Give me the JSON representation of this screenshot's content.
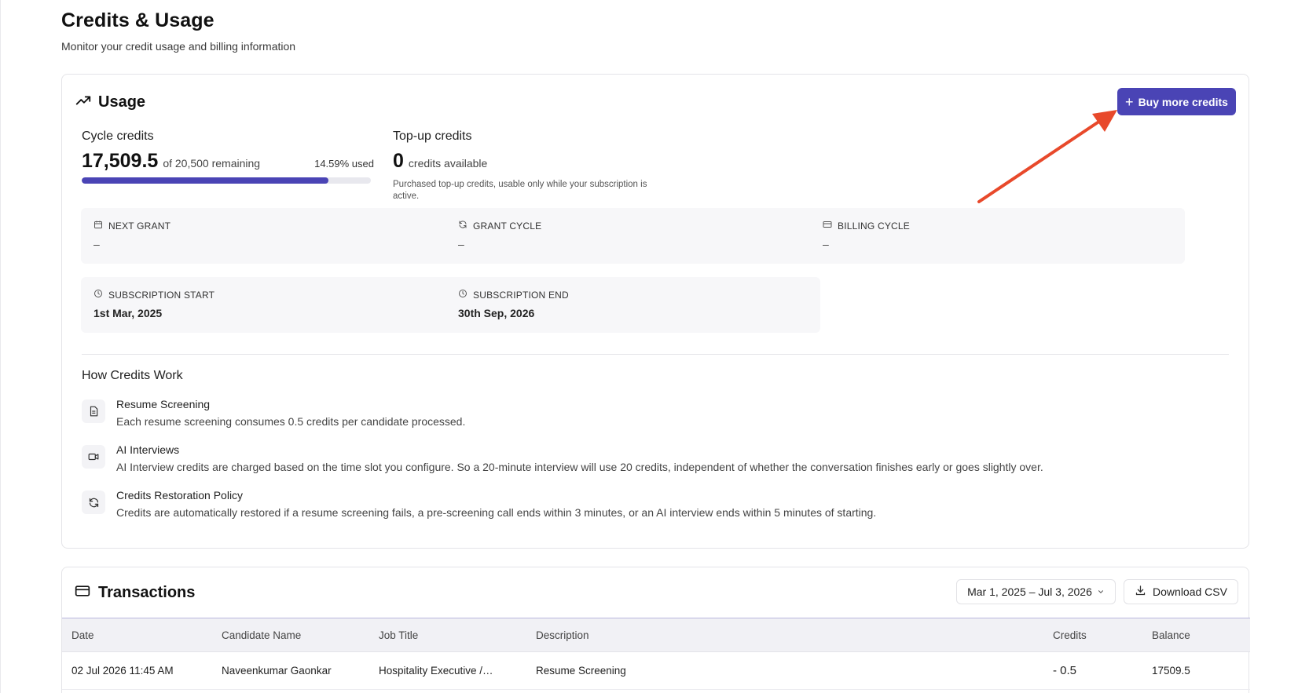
{
  "header": {
    "title": "Credits & Usage",
    "subtitle": "Monitor your credit usage and billing information"
  },
  "usage": {
    "title": "Usage",
    "buy_button": "Buy more credits",
    "cycle": {
      "label": "Cycle credits",
      "remaining": "17,509.5",
      "of_text": "of 20,500 remaining",
      "used_text": "14.59% used",
      "remaining_fraction": 0.8541
    },
    "topup": {
      "label": "Top-up credits",
      "amount": "0",
      "available_text": "credits available",
      "note": "Purchased top-up credits, usable only while your subscription is active."
    },
    "boxes": {
      "next_grant": {
        "label": "NEXT GRANT",
        "value": "–",
        "icon": "calendar-icon"
      },
      "grant_cycle": {
        "label": "GRANT CYCLE",
        "value": "–",
        "icon": "refresh-icon"
      },
      "billing_cycle": {
        "label": "BILLING CYCLE",
        "value": "–",
        "icon": "credit-card-icon"
      },
      "subscription_start": {
        "label": "SUBSCRIPTION START",
        "value": "1st Mar, 2025",
        "icon": "clock-icon"
      },
      "subscription_end": {
        "label": "SUBSCRIPTION END",
        "value": "30th Sep, 2026",
        "icon": "clock-icon"
      }
    },
    "how": {
      "title": "How Credits Work",
      "items": [
        {
          "title": "Resume Screening",
          "desc": "Each resume screening consumes 0.5 credits per candidate processed.",
          "icon": "document-icon"
        },
        {
          "title": "AI Interviews",
          "desc": "AI Interview credits are charged based on the time slot you configure. So a 20-minute interview will use 20 credits, independent of whether the conversation finishes early or goes slightly over.",
          "icon": "video-icon"
        },
        {
          "title": "Credits Restoration Policy",
          "desc": "Credits are automatically restored if a resume screening fails, a pre-screening call ends within 3 minutes, or an AI interview ends within 5 minutes of starting.",
          "icon": "refresh-icon"
        }
      ]
    }
  },
  "transactions": {
    "title": "Transactions",
    "date_range": "Mar 1, 2025 – Jul 3, 2026",
    "download_label": "Download CSV",
    "columns": [
      "Date",
      "Candidate Name",
      "Job Title",
      "Description",
      "Credits",
      "Balance"
    ],
    "rows": [
      {
        "date": "02 Jul 2026 11:45 AM",
        "candidate": "Naveenkumar Gaonkar",
        "job": "Hospitality Executive /…",
        "description": "Resume Screening",
        "credits": "- 0.5",
        "balance": "17509.5"
      }
    ]
  },
  "colors": {
    "accent": "#4a44b5",
    "annotation_arrow": "#e8492b"
  }
}
